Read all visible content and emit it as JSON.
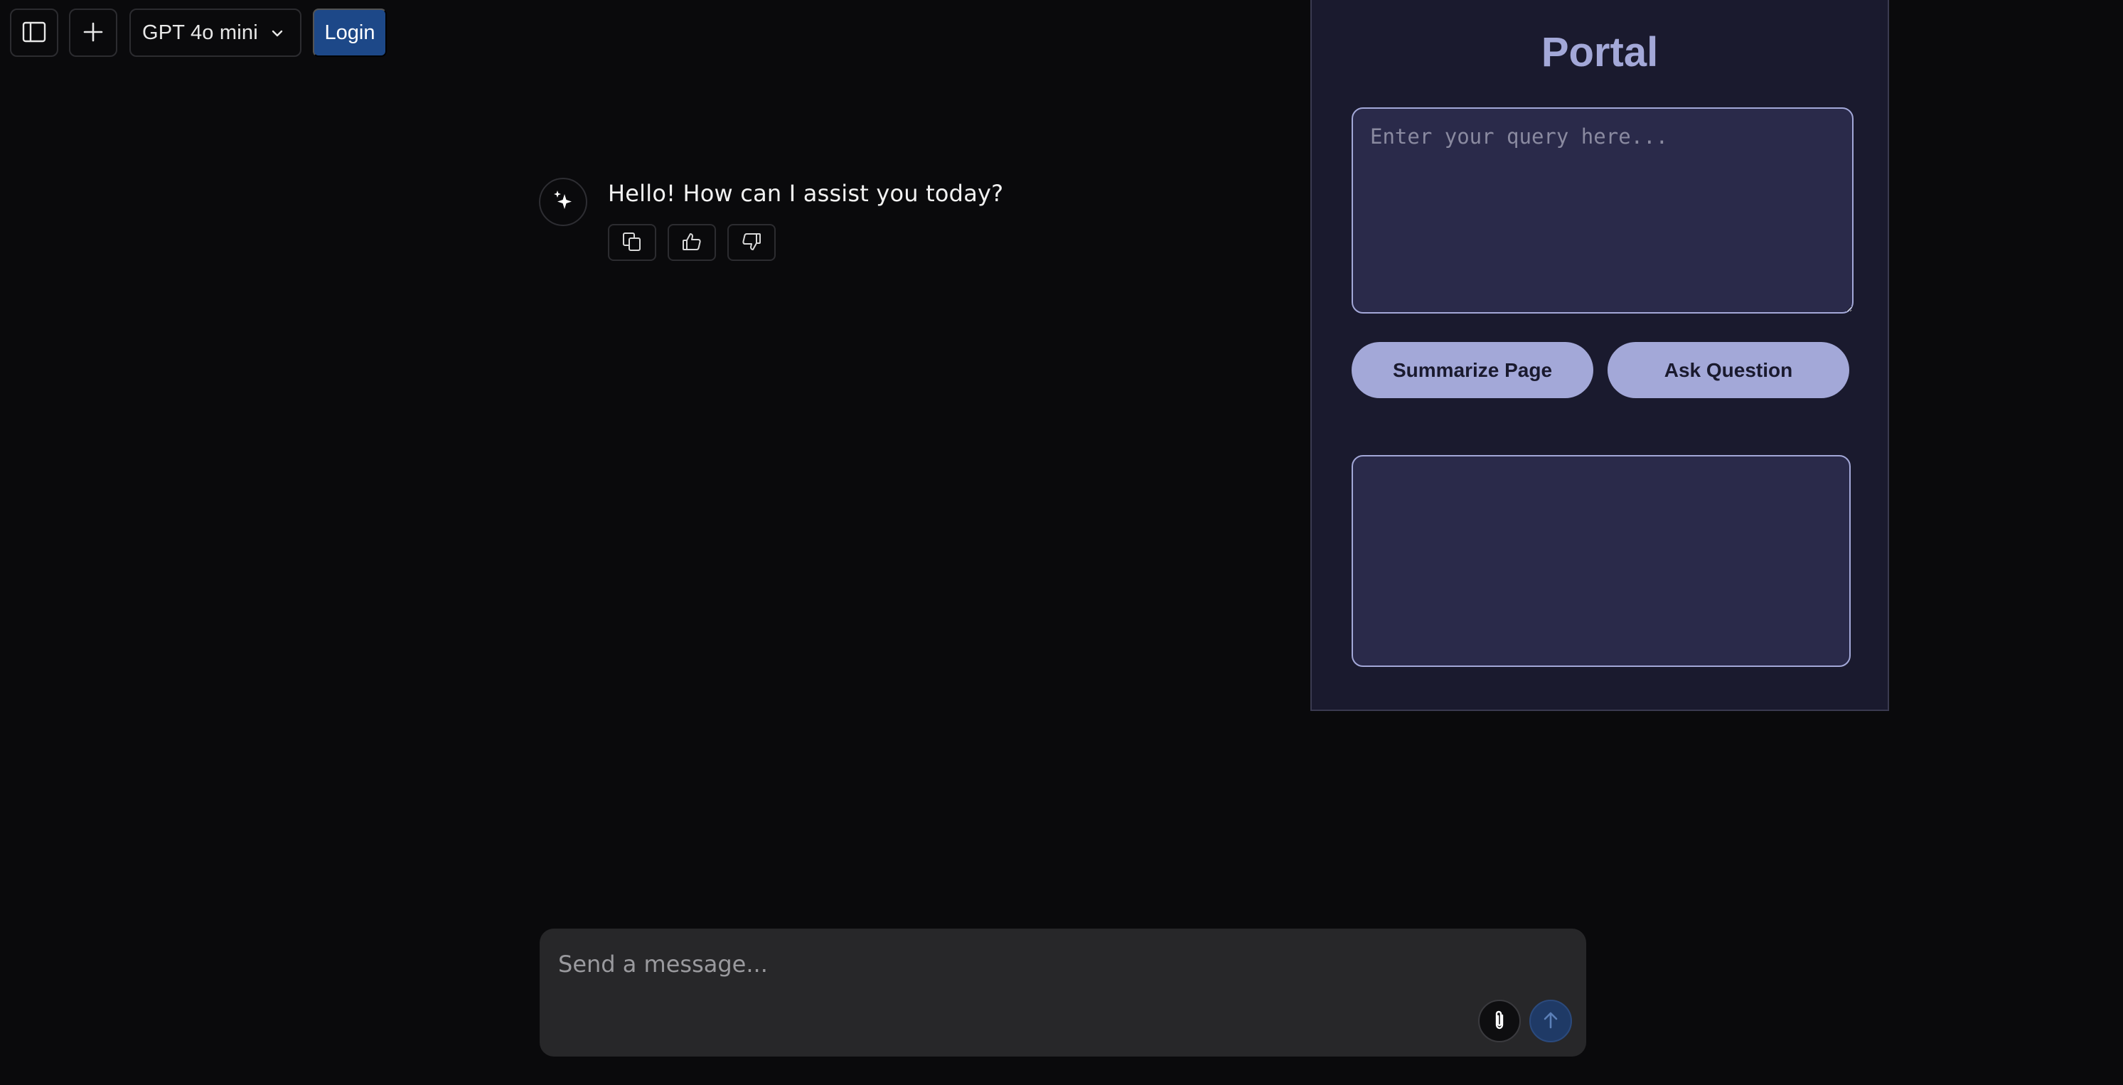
{
  "topbar": {
    "sidebar_toggle_icon": "sidebar-icon",
    "new_chat_icon": "plus-icon",
    "model_label": "GPT 4o mini",
    "model_chevron_icon": "chevron-down-icon",
    "login_label": "Login"
  },
  "message": {
    "avatar_icon": "sparkles-icon",
    "text": "Hello! How can I assist you today?",
    "actions": [
      {
        "icon": "copy-icon"
      },
      {
        "icon": "thumbs-up-icon"
      },
      {
        "icon": "thumbs-down-icon"
      }
    ]
  },
  "portal": {
    "title": "Portal",
    "query_placeholder": "Enter your query here...",
    "query_value": "",
    "summarize_label": "Summarize Page",
    "ask_label": "Ask Question",
    "output_text": "",
    "colors": {
      "panel_bg": "#1a1a2e",
      "field_bg": "#2a2a4a",
      "accent": "#a3a8d8"
    }
  },
  "composer": {
    "placeholder": "Send a message...",
    "value": "",
    "attach_icon": "paperclip-icon",
    "send_icon": "arrow-up-icon"
  },
  "colors": {
    "background": "#0a0a0c",
    "login_bg": "#1d4888",
    "composer_bg": "#272729"
  }
}
